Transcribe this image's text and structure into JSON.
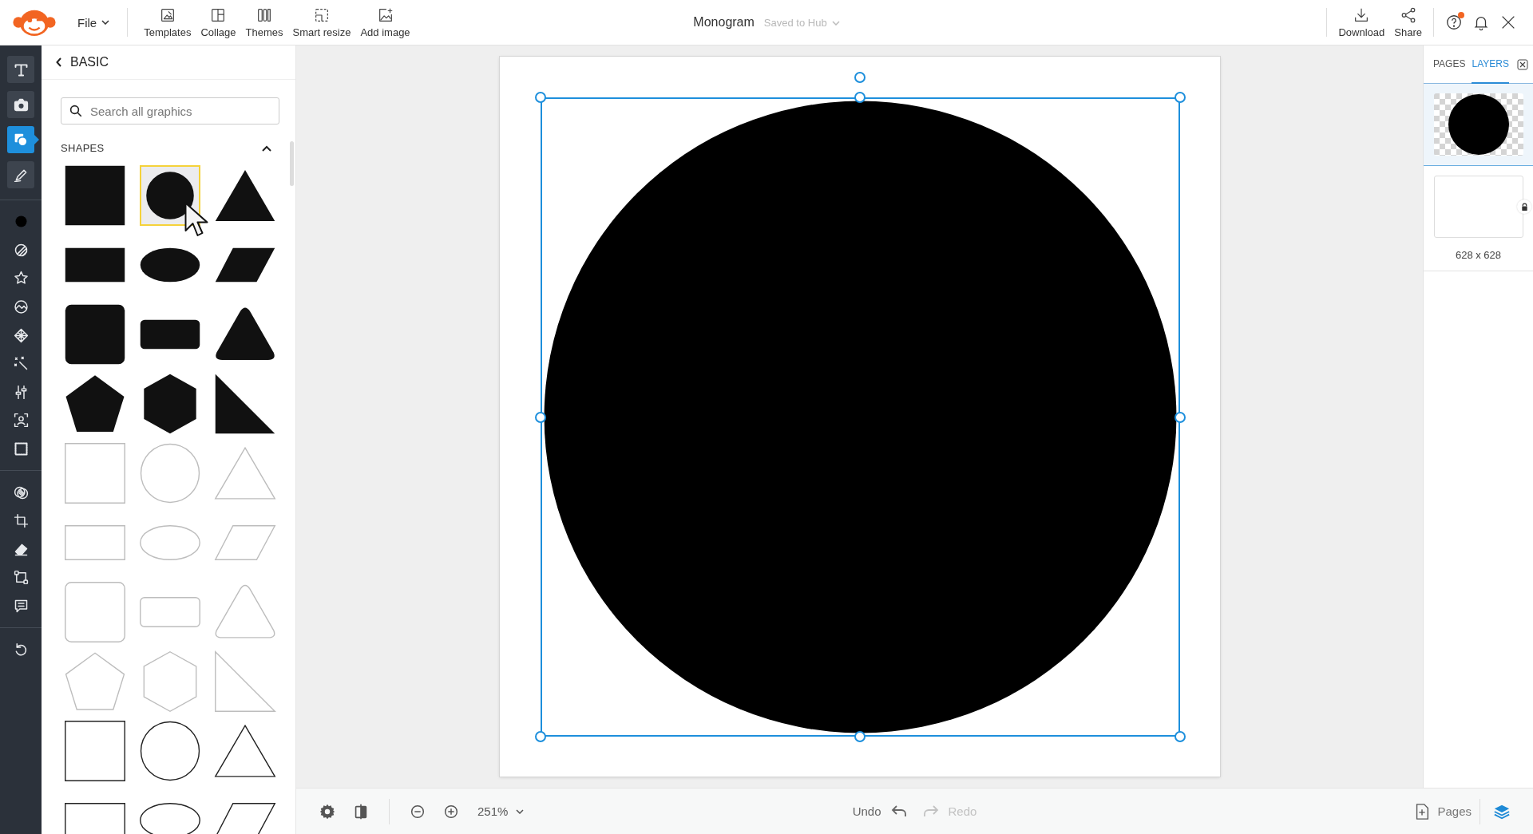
{
  "top_bar": {
    "file_menu": "File",
    "tools": [
      {
        "kind": "templates",
        "label": "Templates"
      },
      {
        "kind": "collage",
        "label": "Collage"
      },
      {
        "kind": "themes",
        "label": "Themes"
      },
      {
        "kind": "resize",
        "label": "Smart resize"
      },
      {
        "kind": "add-image",
        "label": "Add image"
      }
    ],
    "title": "Monogram",
    "save_status": "Saved to Hub",
    "actions": [
      {
        "kind": "download",
        "label": "Download"
      },
      {
        "kind": "share",
        "label": "Share"
      }
    ],
    "help_notification": true
  },
  "tool_rail": [
    {
      "kind": "text",
      "selected": false
    },
    {
      "kind": "camera",
      "selected": false
    },
    {
      "kind": "graphics",
      "selected": true
    },
    {
      "kind": "draw",
      "selected": false
    },
    {
      "kind": "separator"
    },
    {
      "kind": "color",
      "selected": false
    },
    {
      "kind": "texture",
      "selected": false
    },
    {
      "kind": "star",
      "selected": false
    },
    {
      "kind": "effects",
      "selected": false
    },
    {
      "kind": "pattern",
      "selected": false
    },
    {
      "kind": "magic",
      "selected": false
    },
    {
      "kind": "adjust",
      "selected": false
    },
    {
      "kind": "face",
      "selected": false
    },
    {
      "kind": "frame",
      "selected": false
    },
    {
      "kind": "separator"
    },
    {
      "kind": "blend",
      "selected": false
    },
    {
      "kind": "crop",
      "selected": false
    },
    {
      "kind": "eraser",
      "selected": false
    },
    {
      "kind": "transform",
      "selected": false
    },
    {
      "kind": "comment",
      "selected": false
    },
    {
      "kind": "separator"
    },
    {
      "kind": "reset",
      "selected": false
    }
  ],
  "graphics_panel": {
    "back_label": "BASIC",
    "search": {
      "placeholder": "Search all graphics"
    },
    "section": {
      "title": "SHAPES",
      "expanded": true
    },
    "shapes": [
      {
        "kind": "solid-square",
        "selected": false
      },
      {
        "kind": "solid-circle",
        "selected": true
      },
      {
        "kind": "solid-triangle",
        "selected": false
      },
      {
        "kind": "solid-rectangle",
        "selected": false
      },
      {
        "kind": "solid-ellipse",
        "selected": false
      },
      {
        "kind": "solid-parallelogram",
        "selected": false
      },
      {
        "kind": "solid-roundsquare",
        "selected": false
      },
      {
        "kind": "solid-roundrect",
        "selected": false
      },
      {
        "kind": "solid-roundtriangle",
        "selected": false
      },
      {
        "kind": "solid-pentagon",
        "selected": false
      },
      {
        "kind": "solid-hexagon",
        "selected": false
      },
      {
        "kind": "solid-righttriangle",
        "selected": false
      },
      {
        "kind": "thin-square",
        "selected": false
      },
      {
        "kind": "thin-circle",
        "selected": false
      },
      {
        "kind": "thin-triangle",
        "selected": false
      },
      {
        "kind": "thin-rectangle",
        "selected": false
      },
      {
        "kind": "thin-ellipse",
        "selected": false
      },
      {
        "kind": "thin-parallelogram",
        "selected": false
      },
      {
        "kind": "thin-roundsquare",
        "selected": false
      },
      {
        "kind": "thin-roundrect",
        "selected": false
      },
      {
        "kind": "thin-roundtriangle",
        "selected": false
      },
      {
        "kind": "thin-pentagon",
        "selected": false
      },
      {
        "kind": "thin-hexagon",
        "selected": false
      },
      {
        "kind": "thin-righttriangle",
        "selected": false
      },
      {
        "kind": "outline-square",
        "selected": false
      },
      {
        "kind": "outline-circle",
        "selected": false
      },
      {
        "kind": "outline-triangle",
        "selected": false
      },
      {
        "kind": "outline-rectangle",
        "selected": false
      },
      {
        "kind": "outline-ellipse",
        "selected": false
      },
      {
        "kind": "outline-parallelogram",
        "selected": false
      }
    ]
  },
  "canvas": {
    "element": {
      "kind": "circle",
      "selected": true
    }
  },
  "side_panel": {
    "tabs": [
      {
        "label": "PAGES",
        "selected": false
      },
      {
        "label": "LAYERS",
        "selected": true
      }
    ],
    "layers": [
      {
        "kind": "circle",
        "selected": true
      },
      {
        "kind": "page",
        "locked": true,
        "selected": false
      }
    ],
    "page_size": "628 x 628"
  },
  "bottom_bar": {
    "zoom": "251%",
    "undo": {
      "label": "Undo",
      "disabled": false
    },
    "redo": {
      "label": "Redo",
      "disabled": true
    },
    "pages": "Pages"
  }
}
